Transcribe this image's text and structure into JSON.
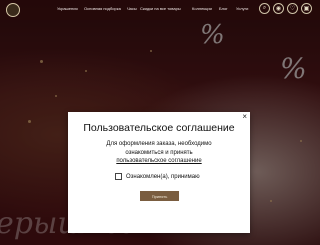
{
  "header": {
    "logo_icon": "store-logo-icon",
    "nav": [
      {
        "label": "Украшения"
      },
      {
        "label": "Основная подборка"
      },
      {
        "label": "Часы"
      },
      {
        "label": "Скидки на все товары"
      },
      {
        "label": "Коллекции"
      },
      {
        "label": "Блог"
      },
      {
        "label": "Услуги"
      }
    ],
    "icons": [
      "search-icon",
      "user-icon",
      "heart-icon",
      "cart-icon"
    ]
  },
  "background": {
    "percent_sign": "%",
    "promo_text": "ерышная"
  },
  "modal": {
    "title": "Пользовательское соглашение",
    "text_line1": "Для оформления заказа, необходимо",
    "text_line2": "ознакомиться и принять",
    "link": "пользовательское соглашение",
    "checkbox_label": "Ознакомлен(а), принимаю",
    "button": "Принять",
    "close": "×"
  },
  "colors": {
    "button": "#7a5d40",
    "overlay": "#000000"
  }
}
